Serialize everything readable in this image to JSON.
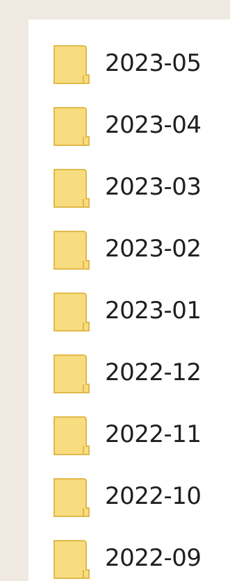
{
  "folder_list": {
    "items": [
      {
        "name": "2023-05",
        "icon": "folder-icon"
      },
      {
        "name": "2023-04",
        "icon": "folder-icon"
      },
      {
        "name": "2023-03",
        "icon": "folder-icon"
      },
      {
        "name": "2023-02",
        "icon": "folder-icon"
      },
      {
        "name": "2023-01",
        "icon": "folder-icon"
      },
      {
        "name": "2022-12",
        "icon": "folder-icon"
      },
      {
        "name": "2022-11",
        "icon": "folder-icon"
      },
      {
        "name": "2022-10",
        "icon": "folder-icon"
      },
      {
        "name": "2022-09",
        "icon": "folder-icon"
      }
    ]
  },
  "colors": {
    "background": "#efe9e1",
    "panel": "#ffffff",
    "folder_fill": "#f8dc80",
    "folder_edge": "#e0b94a",
    "text": "#1f1f1f"
  }
}
